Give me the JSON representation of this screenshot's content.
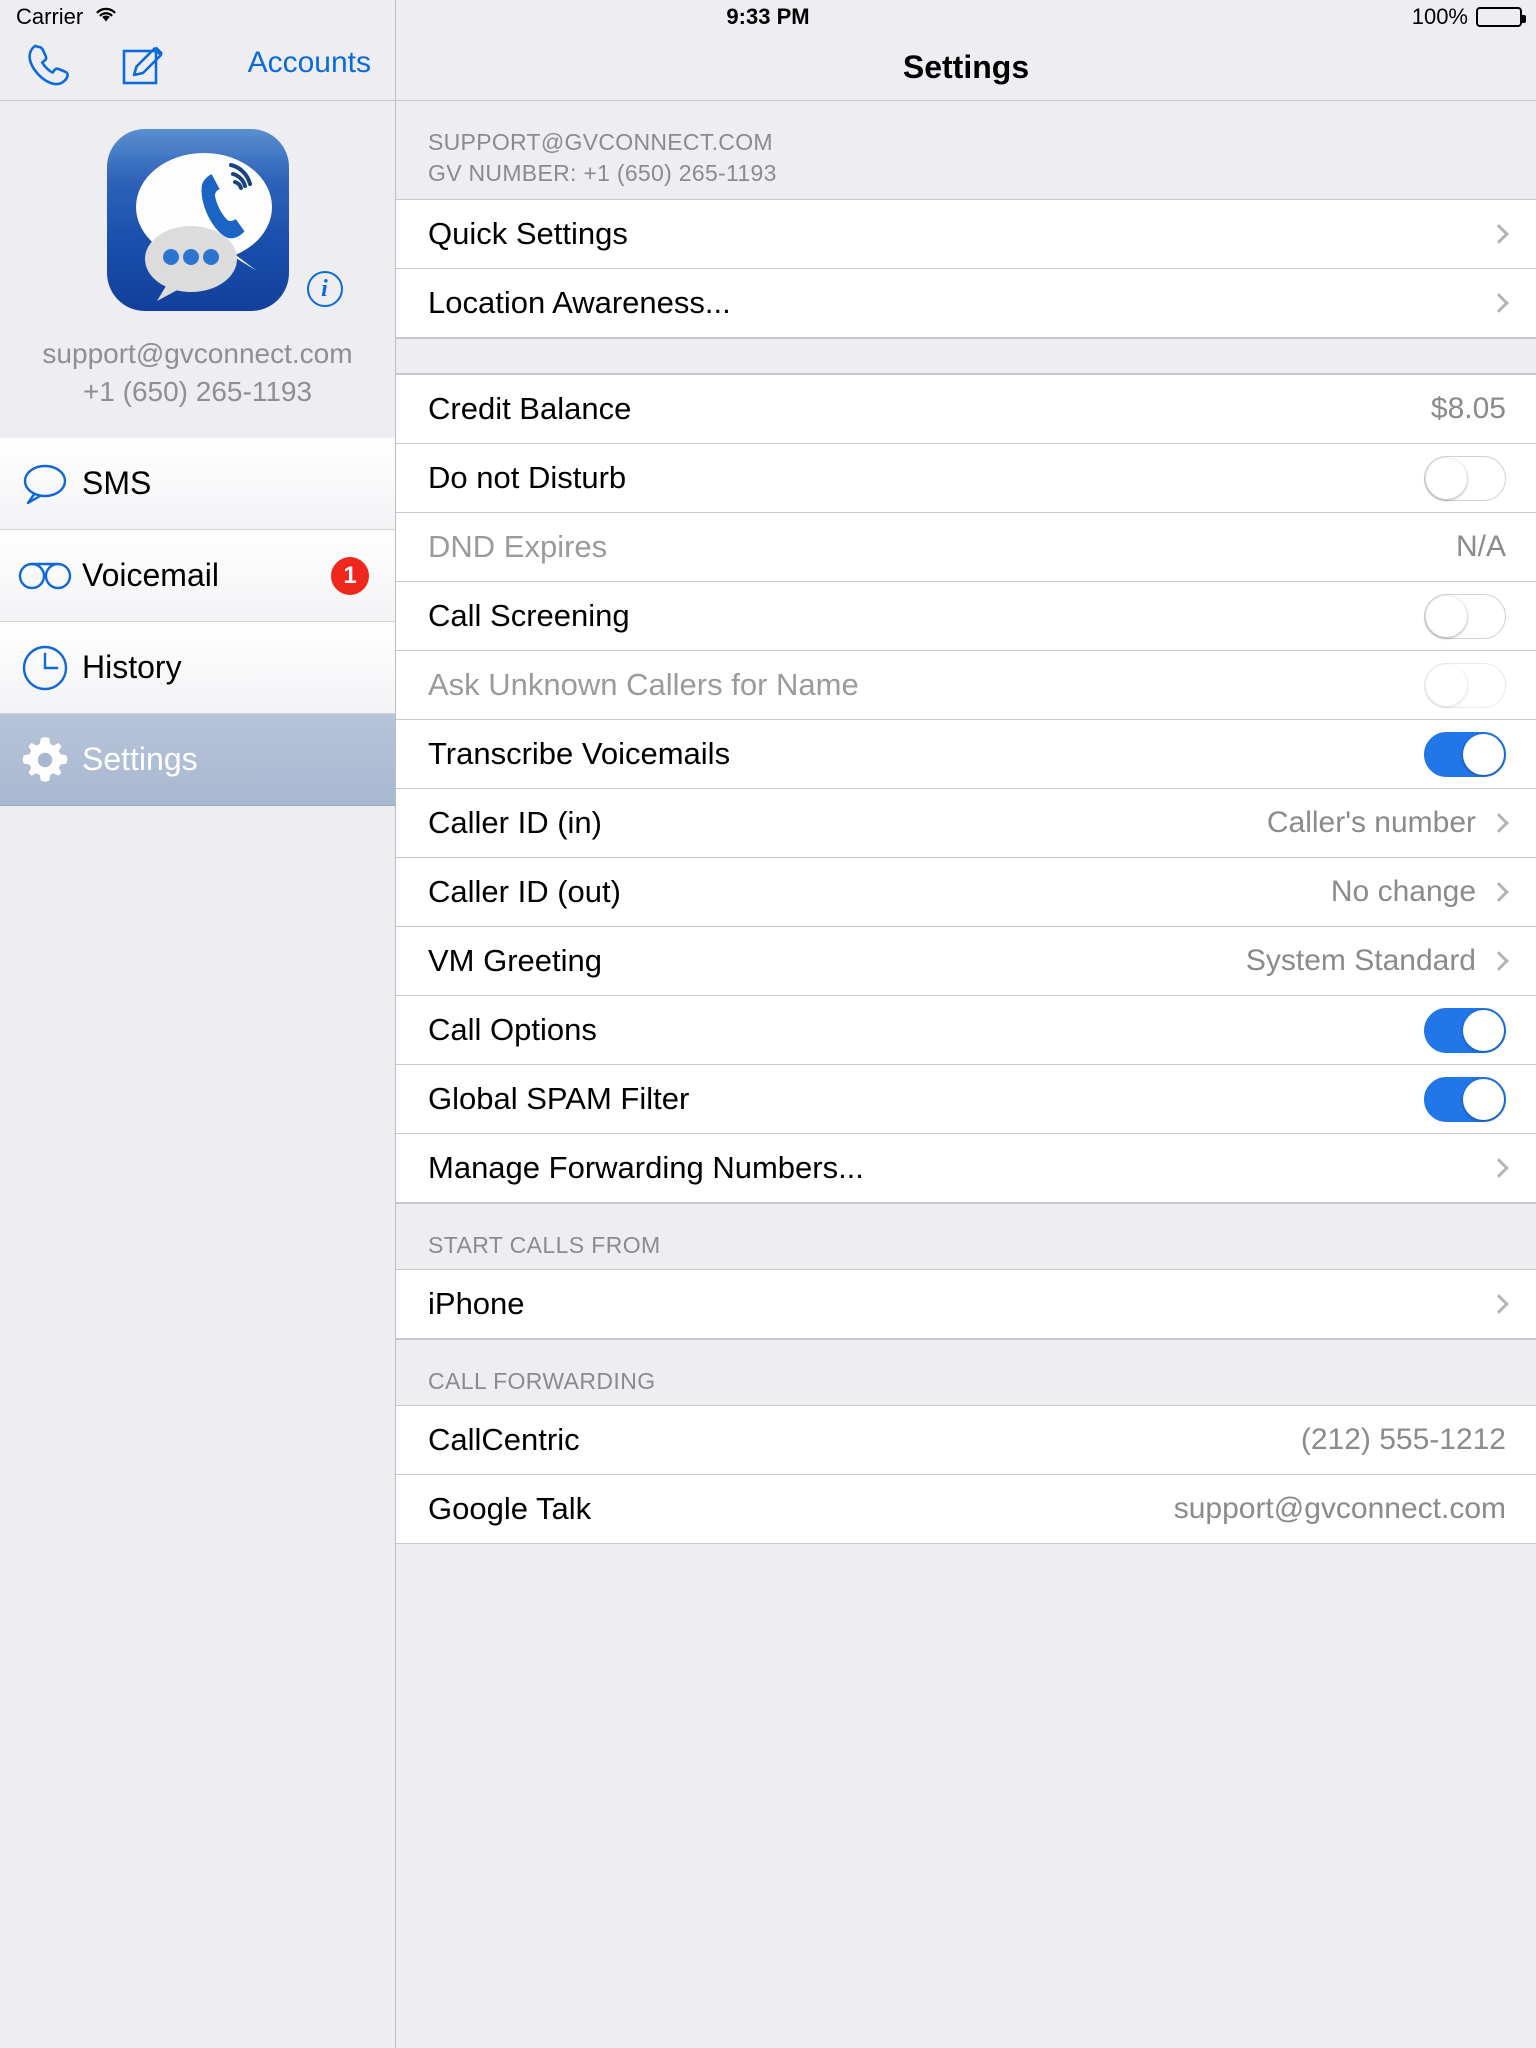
{
  "statusbar": {
    "carrier": "Carrier",
    "wifi_icon": "wifi-icon",
    "time": "9:33 PM",
    "battery_percent": "100%"
  },
  "sidebar": {
    "toolbar": {
      "call_icon": "phone-handset-icon",
      "compose_icon": "compose-pencil-icon",
      "accounts_label": "Accounts"
    },
    "account": {
      "app_icon": "gvconnect-app-icon",
      "info_icon": "info-circle-icon",
      "email": "support@gvconnect.com",
      "phone": "+1 (650) 265-1193"
    },
    "items": [
      {
        "label": "SMS",
        "icon": "speech-bubble-icon",
        "badge": "",
        "selected": false
      },
      {
        "label": "Voicemail",
        "icon": "voicemail-tape-icon",
        "badge": "1",
        "selected": false
      },
      {
        "label": "History",
        "icon": "clock-icon",
        "badge": "",
        "selected": false
      },
      {
        "label": "Settings",
        "icon": "gear-icon",
        "badge": "",
        "selected": true
      }
    ]
  },
  "detail": {
    "title": "Settings",
    "account_header": {
      "line1": "SUPPORT@GVCONNECT.COM",
      "line2": "GV NUMBER: +1 (650) 265-1193"
    },
    "group_top": [
      {
        "label": "Quick Settings",
        "type": "disclosure"
      },
      {
        "label": "Location Awareness...",
        "type": "disclosure"
      }
    ],
    "group_main": [
      {
        "label": "Credit Balance",
        "type": "value",
        "value": "$8.05",
        "dim": false
      },
      {
        "label": "Do not Disturb",
        "type": "toggle",
        "on": false,
        "dim": false,
        "disabled": false
      },
      {
        "label": "DND Expires",
        "type": "value",
        "value": "N/A",
        "dim": true
      },
      {
        "label": "Call Screening",
        "type": "toggle",
        "on": false,
        "dim": false,
        "disabled": false
      },
      {
        "label": "Ask Unknown Callers for Name",
        "type": "toggle",
        "on": false,
        "dim": true,
        "disabled": true
      },
      {
        "label": "Transcribe Voicemails",
        "type": "toggle",
        "on": true,
        "dim": false,
        "disabled": false
      },
      {
        "label": "Caller ID (in)",
        "type": "disclosure-value",
        "value": "Caller's number",
        "dim": false
      },
      {
        "label": "Caller ID (out)",
        "type": "disclosure-value",
        "value": "No change",
        "dim": false
      },
      {
        "label": "VM Greeting",
        "type": "disclosure-value",
        "value": "System Standard",
        "dim": false
      },
      {
        "label": "Call Options",
        "type": "toggle",
        "on": true,
        "dim": false,
        "disabled": false
      },
      {
        "label": "Global SPAM Filter",
        "type": "toggle",
        "on": true,
        "dim": false,
        "disabled": false
      },
      {
        "label": "Manage Forwarding Numbers...",
        "type": "disclosure",
        "value": "",
        "dim": false
      }
    ],
    "start_calls_from": {
      "header": "START CALLS FROM",
      "rows": [
        {
          "label": "iPhone",
          "type": "disclosure",
          "value": ""
        }
      ]
    },
    "call_forwarding": {
      "header": "CALL FORWARDING",
      "rows": [
        {
          "label": "CallCentric",
          "type": "value",
          "value": "(212) 555-1212"
        },
        {
          "label": "Google Talk",
          "type": "value",
          "value": "support@gvconnect.com"
        }
      ]
    }
  },
  "colors": {
    "accent_blue": "#0b6bdb",
    "toggle_on": "#2176e8",
    "badge_red": "#f0271d",
    "selected_row": "#aeb ​c d4"
  }
}
